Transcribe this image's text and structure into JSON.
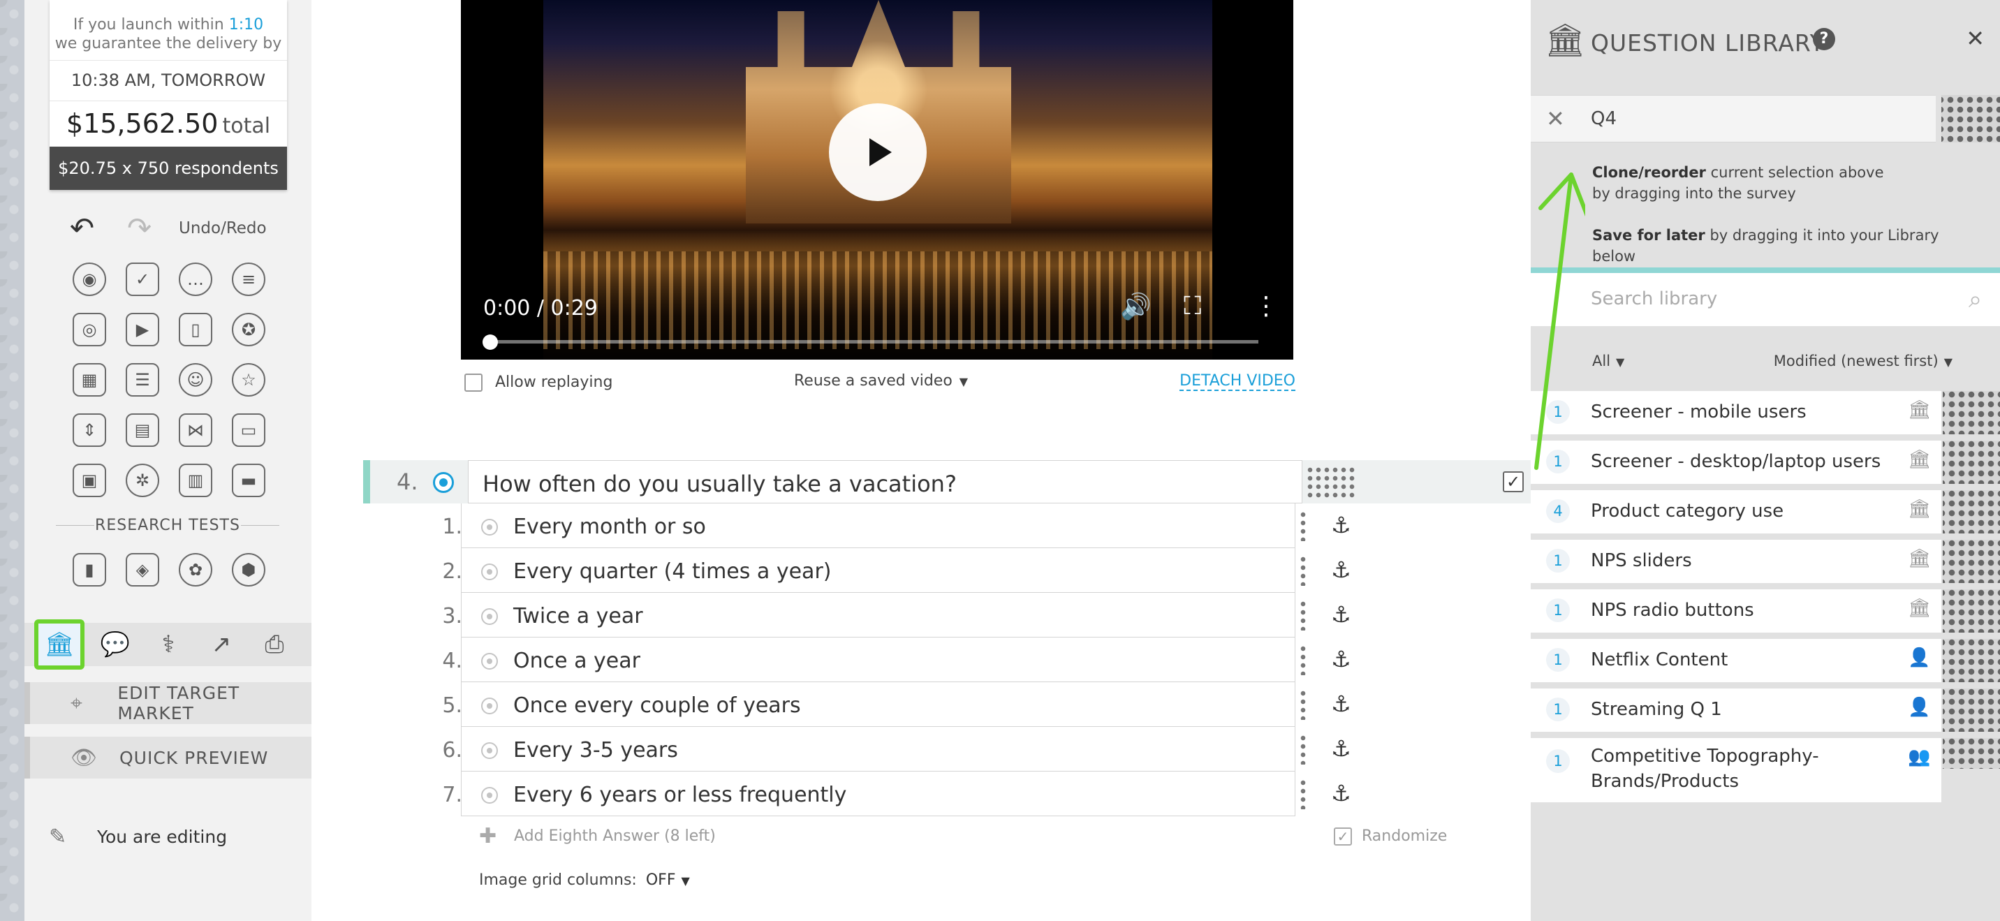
{
  "delivery": {
    "guarantee_prefix": "If you launch within ",
    "guarantee_time": "1:10",
    "guarantee_suffix": "we guarantee the delivery by",
    "delivery_time": "10:38 AM, TOMORROW",
    "total_price": "$15,562.50",
    "total_suffix": "total",
    "per_respondent": "$20.75 x 750 respondents"
  },
  "toolbar": {
    "undo_redo_label": "Undo/Redo",
    "research_tests_label": "RESEARCH TESTS",
    "edit_target_market": "EDIT TARGET MARKET",
    "quick_preview": "QUICK PREVIEW",
    "you_are_editing": "You are editing"
  },
  "video": {
    "time": "0:00 / 0:29",
    "progress": 0.0,
    "allow_replaying_label": "Allow replaying",
    "reuse_label": "Reuse a saved video",
    "detach_label": "DETACH VIDEO"
  },
  "question": {
    "number": "4.",
    "text": "How often do you usually take a vacation?",
    "answers": [
      {
        "num": "1.",
        "text": "Every month or so"
      },
      {
        "num": "2.",
        "text": "Every quarter (4 times a year)"
      },
      {
        "num": "3.",
        "text": "Twice a year"
      },
      {
        "num": "4.",
        "text": "Once a year"
      },
      {
        "num": "5.",
        "text": "Once every couple of years"
      },
      {
        "num": "6.",
        "text": "Every 3-5 years"
      },
      {
        "num": "7.",
        "text": "Every 6 years or less frequently"
      }
    ],
    "add_answer_label": "Add Eighth Answer (8 left)",
    "randomize_label": "Randomize",
    "image_grid_label": "Image grid columns:",
    "image_grid_value": "OFF"
  },
  "library": {
    "title": "QUESTION LIBRARY",
    "selection": "Q4",
    "hint_clone_bold": "Clone/reorder",
    "hint_clone_rest": " current selection above",
    "hint_clone_line2": "by dragging into the survey",
    "hint_save_bold": "Save for later",
    "hint_save_rest": " by dragging it into your Library below",
    "search_placeholder": "Search library",
    "filter_all": "All",
    "sort_label": "Modified (newest first)",
    "items": [
      {
        "count": "1",
        "title": "Screener - mobile users",
        "type_icon": "library-icon"
      },
      {
        "count": "1",
        "title": "Screener - desktop/laptop users",
        "type_icon": "library-icon"
      },
      {
        "count": "4",
        "title": "Product category use",
        "type_icon": "library-icon"
      },
      {
        "count": "1",
        "title": "NPS sliders",
        "type_icon": "library-icon"
      },
      {
        "count": "1",
        "title": "NPS radio buttons",
        "type_icon": "library-icon"
      },
      {
        "count": "1",
        "title": "Netflix Content",
        "type_icon": "person-icon"
      },
      {
        "count": "1",
        "title": "Streaming Q 1",
        "type_icon": "person-icon"
      },
      {
        "count": "1",
        "title": "Competitive Topography-Brands/Products",
        "type_icon": "team-icon"
      }
    ]
  },
  "colors": {
    "accent": "#1a9fd9",
    "highlight_green": "#6cd32e",
    "teal": "#8fd6c6"
  }
}
